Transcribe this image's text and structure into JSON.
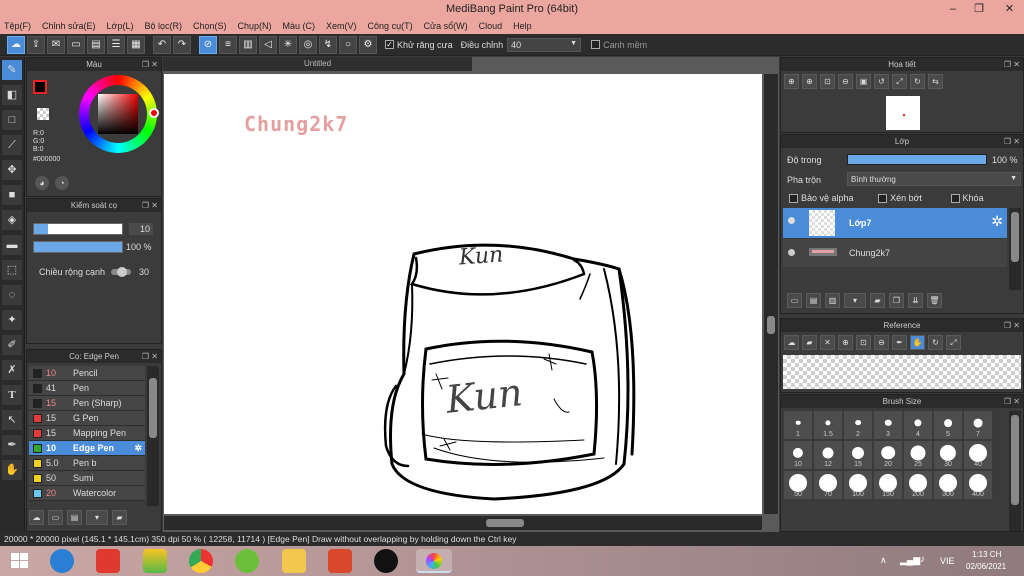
{
  "window": {
    "title": "MediBang Paint Pro (64bit)",
    "minimize": "–",
    "restore": "❐",
    "close": "✕"
  },
  "menu": [
    "Tệp(F)",
    "Chỉnh sửa(E)",
    "Lớp(L)",
    "Bộ lọc(R)",
    "Chọn(S)",
    "Chụp(N)",
    "Màu (C)",
    "Xem(V)",
    "Công cụ(T)",
    "Cửa sổ(W)",
    "Cloud",
    "Help"
  ],
  "toolbar": {
    "antialias_label": "Khử răng cưa",
    "correction_label": "Điều chỉnh",
    "correction_value": "40",
    "snap_label": "Canh mềm"
  },
  "color_panel": {
    "title": "Màu",
    "r": "R:0",
    "g": "G:0",
    "b": "B:0",
    "hex": "#000000"
  },
  "brush_control": {
    "title": "Kiểm soát cọ",
    "size": "10",
    "opacity": "100 %",
    "line_width_label": "Chiều rộng cạnh",
    "line_width_value": "30"
  },
  "brush_list": {
    "title": "Cọ: Edge Pen",
    "items": [
      {
        "size": "10",
        "name": "Pencil",
        "color": "#222222"
      },
      {
        "size": "41",
        "name": "Pen",
        "color": "#222222"
      },
      {
        "size": "15",
        "name": "Pen (Sharp)",
        "color": "#222222"
      },
      {
        "size": "15",
        "name": "G Pen",
        "color": "#e53a3a"
      },
      {
        "size": "15",
        "name": "Mapping Pen",
        "color": "#e53a3a"
      },
      {
        "size": "10",
        "name": "Edge Pen",
        "color": "#2eaa2e"
      },
      {
        "size": "5.0",
        "name": "Pen b",
        "color": "#f0d020"
      },
      {
        "size": "50",
        "name": "Sumi",
        "color": "#f0d020"
      },
      {
        "size": "20",
        "name": "Watercolor",
        "color": "#6ac8f0"
      }
    ]
  },
  "canvas": {
    "tab": "Untitled",
    "watermark": "Chung2k7",
    "bag_text_top": "Kun",
    "bag_text_front": "Kun"
  },
  "navigator": {
    "title": "Họa tiết"
  },
  "layer_panel": {
    "title": "Lớp",
    "opacity_label": "Độ trong",
    "opacity_value": "100 %",
    "opacity_fraction": 1.0,
    "blend_label": "Pha trộn",
    "blend_value": "Bình thường",
    "protect_alpha": "Bảo vệ alpha",
    "clipping": "Xén bớt",
    "lock": "Khóa",
    "layers": [
      {
        "name": "Lớp7",
        "selected": true
      },
      {
        "name": "Chung2k7",
        "selected": false
      }
    ]
  },
  "reference_panel": {
    "title": "Reference"
  },
  "brush_size_panel": {
    "title": "Brush Size",
    "sizes": [
      "1",
      "1.5",
      "2",
      "3",
      "4",
      "5",
      "7",
      "10",
      "12",
      "15",
      "20",
      "25",
      "30",
      "40",
      "50",
      "70",
      "100",
      "150",
      "200",
      "300",
      "400"
    ]
  },
  "status": {
    "text": "20000 * 20000 pixel  (145.1 * 145.1cm)  350 dpi  50 %  ( 12258, 11714 )  [Edge Pen] Draw without overlapping by holding down the Ctrl key"
  },
  "taskbar": {
    "time": "1:13 CH",
    "date": "02/06/2021",
    "lang": "VIE"
  },
  "colors": {
    "accent": "#4a8cd8",
    "titlebar": "#eba79f",
    "panel": "#3b3b3b"
  }
}
